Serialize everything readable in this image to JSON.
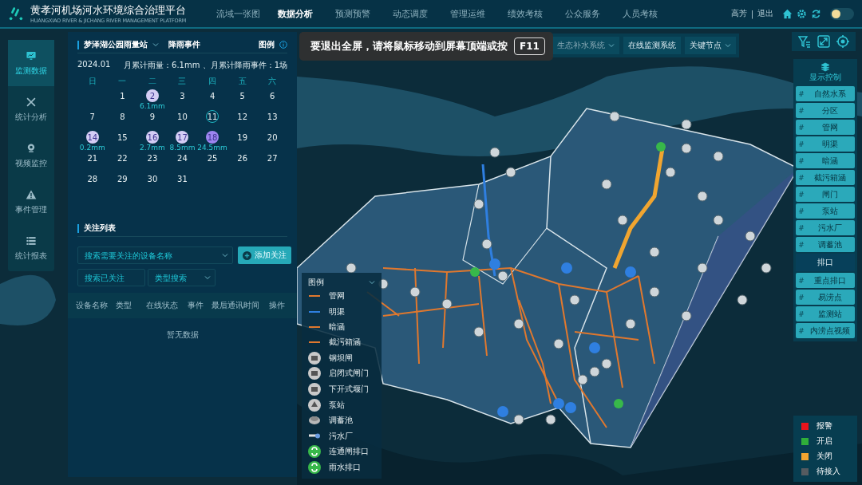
{
  "header": {
    "title": "黄孝河机场河水环境综合治理平台",
    "subtitle": "HUANGXIAO RIVER & JICHANG RIVER MANAGEMENT PLATFORM",
    "nav": [
      {
        "label": "流域一张图",
        "selected": false
      },
      {
        "label": "数据分析",
        "selected": true
      },
      {
        "label": "预测预警",
        "selected": false
      },
      {
        "label": "动态调度",
        "selected": false
      },
      {
        "label": "管理运维",
        "selected": false
      },
      {
        "label": "绩效考核",
        "selected": false
      },
      {
        "label": "公众服务",
        "selected": false
      },
      {
        "label": "人员考核",
        "selected": false
      }
    ],
    "user": "高芳",
    "separator": "|",
    "logout": "退出",
    "light_mode": false
  },
  "sidebar": {
    "items": [
      {
        "label": "监测数据",
        "selected": true
      },
      {
        "label": "统计分析",
        "selected": false
      },
      {
        "label": "视频监控",
        "selected": false
      },
      {
        "label": "事件管理",
        "selected": false
      },
      {
        "label": "统计报表",
        "selected": false
      }
    ]
  },
  "rain_panel": {
    "station": "梦泽湖公园雨量站",
    "tab": "降雨事件",
    "legend_link": "图例",
    "month": "2024.01",
    "summary": "月累计雨量：6.1mm 、月累计降雨事件：1场",
    "weekdays": [
      "日",
      "一",
      "二",
      "三",
      "四",
      "五",
      "六"
    ],
    "days": [
      {
        "day": "1"
      },
      {
        "day": "2",
        "rain": "6.1mm",
        "color": "#d4cdf5"
      },
      {
        "day": "3"
      },
      {
        "day": "4"
      },
      {
        "day": "5"
      },
      {
        "day": "6"
      },
      {
        "day": "7"
      },
      {
        "day": "8"
      },
      {
        "day": "9"
      },
      {
        "day": "10"
      },
      {
        "day": "11",
        "today": true
      },
      {
        "day": "12"
      },
      {
        "day": "13"
      },
      {
        "day": "14",
        "rain": "0.2mm",
        "color": "#d4cdf5"
      },
      {
        "day": "15"
      },
      {
        "day": "16",
        "rain": "2.7mm",
        "color": "#d4cdf5"
      },
      {
        "day": "17",
        "rain": "8.5mm",
        "color": "#d4cdf5"
      },
      {
        "day": "18",
        "rain": "24.5mm",
        "color": "#9d85f0"
      },
      {
        "day": "19"
      },
      {
        "day": "20"
      },
      {
        "day": "21"
      },
      {
        "day": "22"
      },
      {
        "day": "23"
      },
      {
        "day": "24"
      },
      {
        "day": "25"
      },
      {
        "day": "26"
      },
      {
        "day": "27"
      },
      {
        "day": "28"
      },
      {
        "day": "29"
      },
      {
        "day": "30"
      },
      {
        "day": "31"
      }
    ]
  },
  "watch_list": {
    "title": "关注列表",
    "device_search": {
      "placeholder": "搜索需要关注的设备名称"
    },
    "add_button": "添加关注",
    "watched_search": {
      "placeholder": "搜索已关注"
    },
    "type_search": {
      "placeholder": "类型搜索"
    },
    "columns": [
      "设备名称",
      "类型",
      "在线状态",
      "事件",
      "最后通讯时间",
      "操作"
    ],
    "empty": "暂无数据"
  },
  "toolbar": [
    "生态补水系统",
    "在线监测系统",
    "关键节点"
  ],
  "toast": {
    "message": "要退出全屏，请将鼠标移动到屏幕顶端或按",
    "key": "F11"
  },
  "map_legend": {
    "title": "图例",
    "items": [
      {
        "kind": "line",
        "label": "管网",
        "color": "#e0782e"
      },
      {
        "kind": "line",
        "label": "明渠",
        "color": "#2f7fe0"
      },
      {
        "kind": "line",
        "label": "暗涵",
        "color": "#e0782e"
      },
      {
        "kind": "line",
        "label": "截污箱涵",
        "color": "#e0782e"
      },
      {
        "kind": "gate",
        "label": "钢坝闸"
      },
      {
        "kind": "gate",
        "label": "启闭式闸门"
      },
      {
        "kind": "gate",
        "label": "下开式堰门"
      },
      {
        "kind": "pump",
        "label": "泵站"
      },
      {
        "kind": "pool",
        "label": "调蓄池"
      },
      {
        "kind": "plant",
        "label": "污水厂"
      },
      {
        "kind": "outlet",
        "label": "连通闸排口"
      },
      {
        "kind": "outlet",
        "label": "雨水排口"
      }
    ]
  },
  "display_control": {
    "title": "显示控制",
    "marker": "#",
    "items": [
      {
        "kind": "toggle",
        "label": "自然水系",
        "on": true
      },
      {
        "kind": "toggle",
        "label": "分区",
        "on": true
      },
      {
        "kind": "toggle",
        "label": "管网",
        "on": true
      },
      {
        "kind": "toggle",
        "label": "明渠",
        "on": true
      },
      {
        "kind": "toggle",
        "label": "暗涵",
        "on": true
      },
      {
        "kind": "toggle",
        "label": "截污箱涵",
        "on": true
      },
      {
        "kind": "toggle",
        "label": "闸门",
        "on": true
      },
      {
        "kind": "toggle",
        "label": "泵站",
        "on": true
      },
      {
        "kind": "toggle",
        "label": "污水厂",
        "on": true
      },
      {
        "kind": "toggle",
        "label": "调蓄池",
        "on": true
      },
      {
        "kind": "group",
        "label": "排口"
      },
      {
        "kind": "toggle",
        "label": "重点排口",
        "on": true
      },
      {
        "kind": "toggle",
        "label": "易涝点",
        "on": true
      },
      {
        "kind": "toggle",
        "label": "监测站",
        "on": true
      },
      {
        "kind": "toggle",
        "label": "内涝点视频",
        "on": true
      }
    ]
  },
  "status_legend": [
    {
      "label": "报警",
      "color": "#e8141c"
    },
    {
      "label": "开启",
      "color": "#2fae3a"
    },
    {
      "label": "关闭",
      "color": "#f0a530"
    },
    {
      "label": "待接入",
      "color": "#555b60"
    }
  ]
}
